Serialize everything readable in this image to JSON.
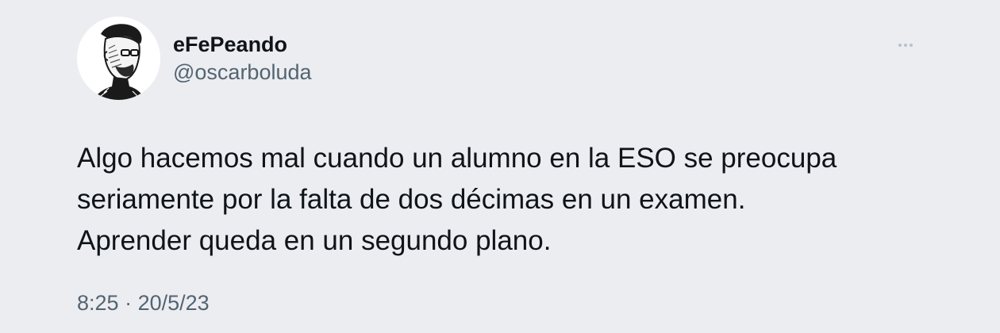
{
  "author": {
    "display_name": "eFePeando",
    "handle": "@oscarboluda",
    "avatar_icon": "portrait-sketch-avatar"
  },
  "menu": {
    "icon": "more-options-icon"
  },
  "tweet": {
    "lines": [
      "Algo hacemos mal cuando un alumno en la ESO se preocupa",
      "seriamente por la falta de dos décimas en un examen.",
      "Aprender queda en un segundo plano."
    ]
  },
  "meta": {
    "time": "8:25",
    "separator": "·",
    "date": "20/5/23"
  },
  "colors": {
    "background": "#ecedf1",
    "text_primary": "#0f1419",
    "text_secondary": "#536471"
  }
}
